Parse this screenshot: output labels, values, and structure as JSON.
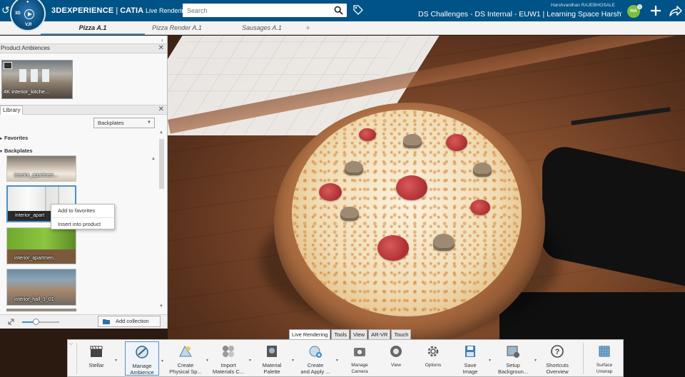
{
  "compass": {
    "labels": [
      "3D",
      "V,R"
    ]
  },
  "brand": {
    "company": "3DEXPERIENCE",
    "separator": "|",
    "app": "CATIA",
    "module": "Live Rendering"
  },
  "search": {
    "placeholder": "Search"
  },
  "context": "DS Challenges - DS Internal - EUW1 | Learning Space Harsh",
  "user": {
    "name": "Harshvardhan RAJEBHOSALE",
    "initials": "HA"
  },
  "tabs": [
    "Pizza A.1",
    "Pizza Render A.1",
    "Sausages A.1"
  ],
  "tab_add": "+",
  "panel": {
    "ambiences": {
      "title": "Product Ambiences",
      "close": "✕",
      "thumb_label": "4K interior_kitche..."
    },
    "library": {
      "title": "Library",
      "close": "✕",
      "dropdown": "Backplates",
      "favorites": "Favorites",
      "backplates": "Backplates",
      "items": [
        {
          "label": "interior_apartmen..."
        },
        {
          "label": "interior_apart"
        },
        {
          "label": "interior_apartmen..."
        },
        {
          "label": "interior_hall_1_01"
        }
      ],
      "context_menu": [
        "Add to favorites",
        "Insert into product"
      ],
      "zoom_level": 0.38,
      "add_collection": "Add collection"
    }
  },
  "action_bar": {
    "tabs": [
      "Live Rendering",
      "Tools",
      "View",
      "AR-VR",
      "Touch"
    ],
    "commands": [
      {
        "label1": "Stellar",
        "label2": "",
        "icon": "stellar-icon"
      },
      {
        "label1": "Manage",
        "label2": "Ambience",
        "icon": "manage-ambience-icon"
      },
      {
        "label1": "Create",
        "label2": "Physical Sp...",
        "icon": "physical-sky-icon"
      },
      {
        "label1": "Import",
        "label2": "Materials C...",
        "icon": "import-materials-icon"
      },
      {
        "label1": "Material",
        "label2": "Palette",
        "icon": "material-palette-icon"
      },
      {
        "label1": "Create",
        "label2": "and Apply ...",
        "icon": "create-apply-icon"
      },
      {
        "label1": "Manage",
        "label2": "Camera",
        "icon": "camera-icon"
      },
      {
        "label1": "View",
        "label2": "",
        "icon": "view-icon"
      },
      {
        "label1": "Options",
        "label2": "",
        "icon": "gear-icon"
      },
      {
        "label1": "Save",
        "label2": "Image",
        "icon": "save-image-icon"
      },
      {
        "label1": "Setup",
        "label2": "Backgroun...",
        "icon": "setup-background-icon"
      },
      {
        "label1": "Shortcuts",
        "label2": "Overview",
        "icon": "help-icon"
      },
      {
        "label1": "Surface",
        "label2": "Unwrap",
        "icon": "surface-unwrap-icon"
      }
    ]
  },
  "colors": {
    "topbar": "#005386",
    "accent": "#368ec4",
    "avatar": "#7bbf3f"
  }
}
